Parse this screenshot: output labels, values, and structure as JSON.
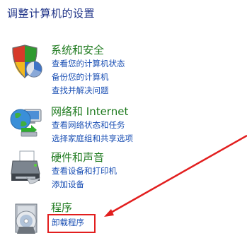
{
  "page": {
    "title": "调整计算机的设置"
  },
  "categories": [
    {
      "icon": "shield-security-icon",
      "title": "系统和安全",
      "links": [
        "查看您的计算机状态",
        "备份您的计算机",
        "查找并解决问题"
      ]
    },
    {
      "icon": "globe-network-icon",
      "title": "网络和 Internet",
      "links": [
        "查看网络状态和任务",
        "选择家庭组和共享选项"
      ]
    },
    {
      "icon": "printer-hardware-icon",
      "title": "硬件和声音",
      "links": [
        "查看设备和打印机",
        "添加设备"
      ]
    },
    {
      "icon": "programs-disc-icon",
      "title": "程序",
      "links": [
        "卸载程序"
      ]
    }
  ],
  "annotation": {
    "color": "#e21e1e",
    "highlighted_link": "卸载程序"
  }
}
